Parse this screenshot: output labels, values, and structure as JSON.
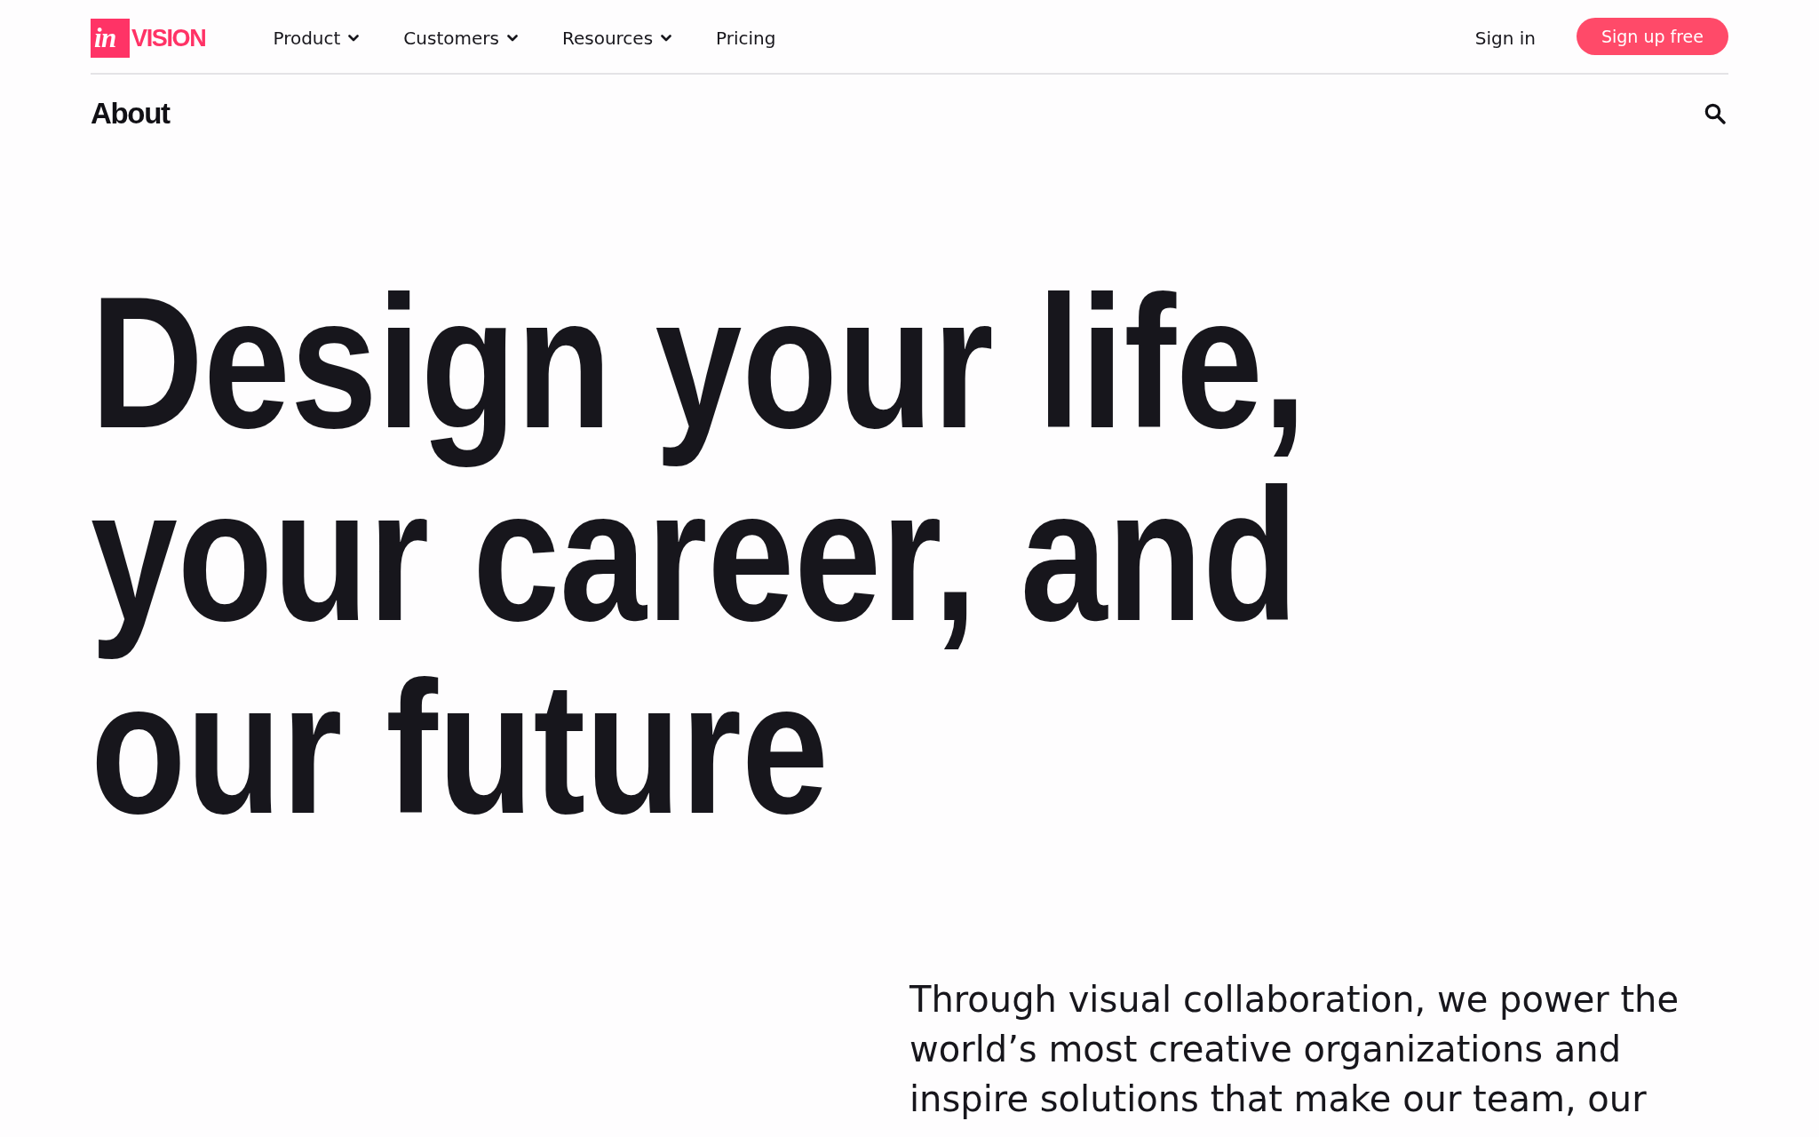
{
  "header": {
    "logo": {
      "mark": "in",
      "wordmark": "VISION"
    },
    "nav": [
      {
        "label": "Product",
        "dropdown": true
      },
      {
        "label": "Customers",
        "dropdown": true
      },
      {
        "label": "Resources",
        "dropdown": true
      },
      {
        "label": "Pricing",
        "dropdown": false
      }
    ],
    "sign_in": "Sign in",
    "sign_up": "Sign up free"
  },
  "subnav": {
    "title": "About"
  },
  "hero": {
    "headline": "Design your life, your career, and our future"
  },
  "intro": {
    "text": "Through visual collaboration, we power the world’s most creative organizations and inspire solutions that make our team, our"
  }
}
